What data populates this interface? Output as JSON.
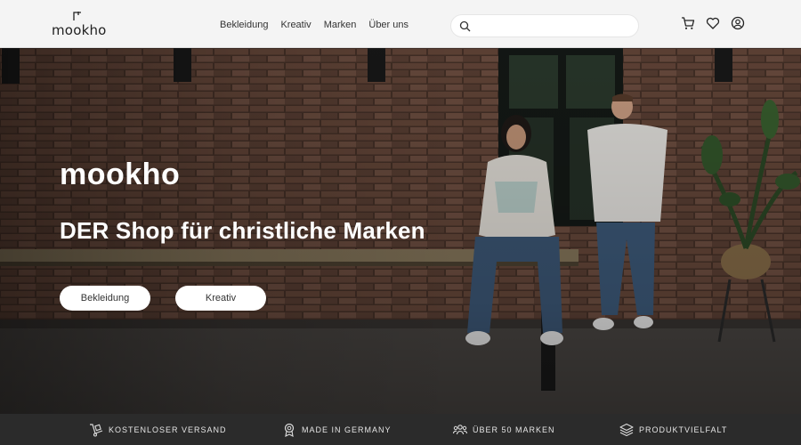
{
  "header": {
    "logo_text": "mookho",
    "nav": [
      "Bekleidung",
      "Kreativ",
      "Marken",
      "Über uns"
    ],
    "search": {
      "placeholder": "",
      "value": ""
    },
    "icons": [
      "cart-icon",
      "heart-icon",
      "user-icon"
    ]
  },
  "hero": {
    "title": "mookho",
    "subtitle": "DER Shop für christliche Marken",
    "buttons": [
      "Bekleidung",
      "Kreativ"
    ]
  },
  "usps": [
    {
      "icon": "hand-truck-icon",
      "label": "KOSTENLOSER VERSAND"
    },
    {
      "icon": "award-badge-icon",
      "label": "MADE IN GERMANY"
    },
    {
      "icon": "users-group-icon",
      "label": "ÜBER 50 MARKEN"
    },
    {
      "icon": "layers-icon",
      "label": "PRODUKTVIELFALT"
    }
  ],
  "colors": {
    "header_bg": "#f4f4f4",
    "footer_bar": "#2b2b2b",
    "button_bg": "#ffffff"
  }
}
